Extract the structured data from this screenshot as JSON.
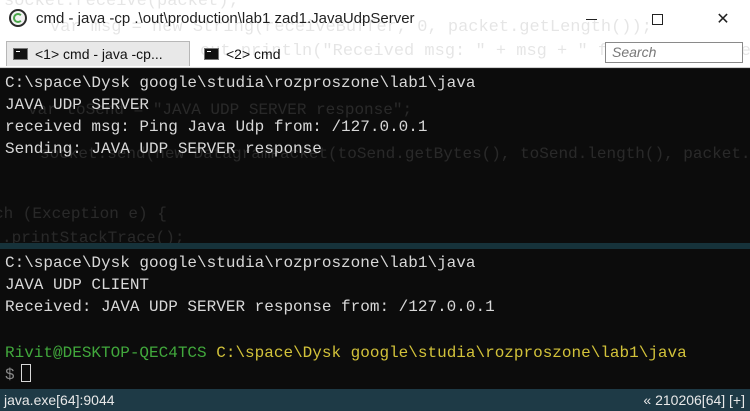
{
  "window": {
    "title": "cmd - java  -cp .\\out\\production\\lab1 zad1.JavaUdpServer",
    "minimize_glyph": "",
    "maximize_glyph": "",
    "close_glyph": "✕"
  },
  "tabs": [
    {
      "label": "<1> cmd - java  -cp..."
    },
    {
      "label": "<2> cmd"
    }
  ],
  "search": {
    "placeholder": "Search"
  },
  "pane_top": {
    "lines": [
      "C:\\space\\Dysk google\\studia\\rozproszone\\lab1\\java",
      "JAVA UDP SERVER",
      "received msg: Ping Java Udp from: /127.0.0.1",
      "Sending: JAVA UDP SERVER response"
    ]
  },
  "pane_bottom": {
    "lines": [
      "C:\\space\\Dysk google\\studia\\rozproszone\\lab1\\java",
      "JAVA UDP CLIENT",
      "Received: JAVA UDP SERVER response from: /127.0.0.1"
    ],
    "prompt_user": "Rivit@DESKTOP-QEC4TCS",
    "prompt_path": "C:\\space\\Dysk google\\studia\\rozproszone\\lab1\\java",
    "prompt_symbol": "$"
  },
  "status": {
    "left": "java.exe[64]:9044",
    "right": "« 210206[64] [+]"
  },
  "colors": {
    "prompt_user": "#41a83c",
    "prompt_path": "#d2c23a",
    "status_bg": "#1e3a46",
    "splitter": "#16323a"
  }
}
